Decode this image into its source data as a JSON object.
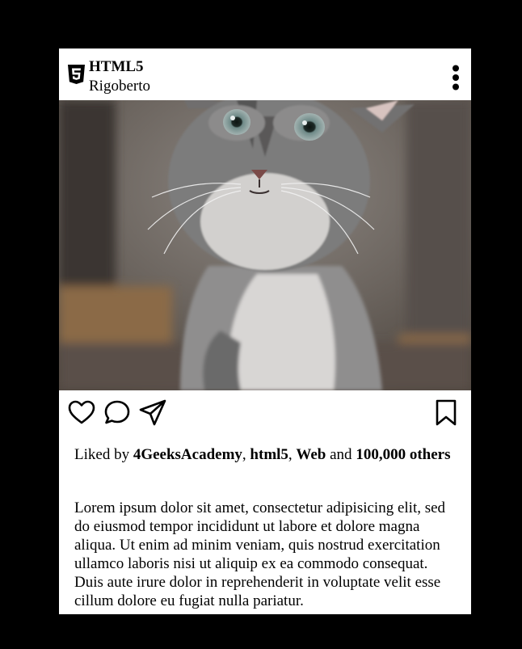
{
  "post": {
    "brand_name": "HTML5",
    "brand_icon": "html5-logo-icon",
    "username": "Rigoberto",
    "more_icon": "vertical-dots-icon",
    "image_subject": "kitten photo",
    "actions": {
      "like_icon": "heart-outline-icon",
      "comment_icon": "speech-bubble-icon",
      "share_icon": "paper-plane-icon",
      "save_icon": "bookmark-outline-icon"
    },
    "likes": {
      "prefix": "Liked by ",
      "user1": "4GeeksAcademy",
      "sep1": ", ",
      "user2": "html5",
      "sep2": ", ",
      "user3": "Web",
      "conj": " and ",
      "others": "100,000 others"
    },
    "caption": "Lorem ipsum dolor sit amet, consectetur adipisicing elit, sed do eiusmod tempor incididunt ut labore et dolore magna aliqua. Ut enim ad minim veniam, quis nostrud exercitation ullamco laboris nisi ut aliquip ex ea commodo consequat. Duis aute irure dolor in reprehenderit in voluptate velit esse cillum dolore eu fugiat nulla pariatur."
  }
}
